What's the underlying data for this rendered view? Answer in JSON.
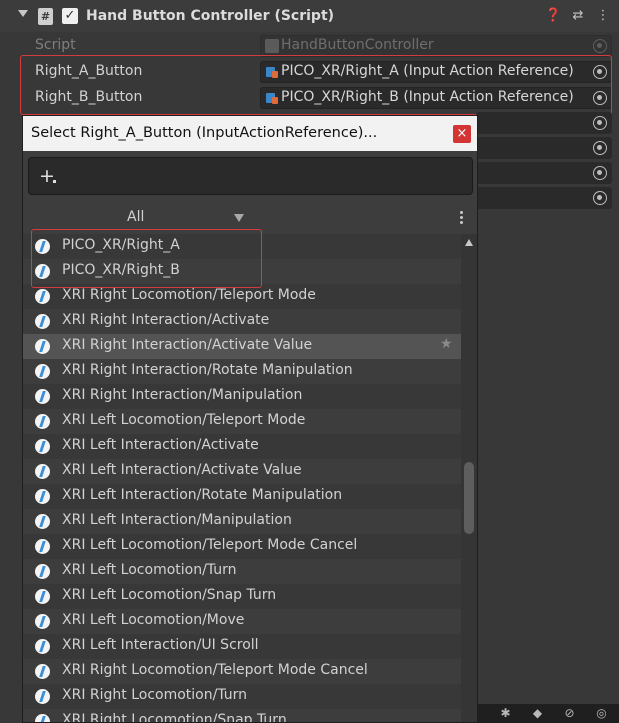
{
  "component": {
    "title": "Hand Button Controller (Script)",
    "help_icon": "help-icon",
    "presets_icon": "presets-icon",
    "menu_icon": "kebab-menu-icon"
  },
  "properties": [
    {
      "label": "Script",
      "value": "HandButtonController",
      "disabled": true
    },
    {
      "label": "Right_A_Button",
      "value": "PICO_XR/Right_A (Input Action Reference)"
    },
    {
      "label": "Right_B_Button",
      "value": "PICO_XR/Right_B (Input Action Reference)"
    }
  ],
  "picker": {
    "title": "Select Right_A_Button (InputActionReference)...",
    "close_label": "×",
    "add_label": "+",
    "filter_label": "All",
    "items": [
      "PICO_XR/Right_A",
      "PICO_XR/Right_B",
      "XRI Right Locomotion/Teleport Mode",
      "XRI Right Interaction/Activate",
      "XRI Right Interaction/Activate Value",
      "XRI Right Interaction/Rotate Manipulation",
      "XRI Right Interaction/Manipulation",
      "XRI Left Locomotion/Teleport Mode",
      "XRI Left Interaction/Activate",
      "XRI Left Interaction/Activate Value",
      "XRI Left Interaction/Rotate Manipulation",
      "XRI Left Interaction/Manipulation",
      "XRI Left Locomotion/Teleport Mode Cancel",
      "XRI Left Locomotion/Turn",
      "XRI Left Locomotion/Snap Turn",
      "XRI Left Locomotion/Move",
      "XRI Left Interaction/UI Scroll",
      "XRI Right Locomotion/Teleport Mode Cancel",
      "XRI Right Locomotion/Turn",
      "XRI Right Locomotion/Snap Turn"
    ],
    "selected_index": 4
  },
  "colors": {
    "highlight_box": "#d23c3c",
    "close_button": "#d33535",
    "action_icon": "#3c8fd6"
  }
}
